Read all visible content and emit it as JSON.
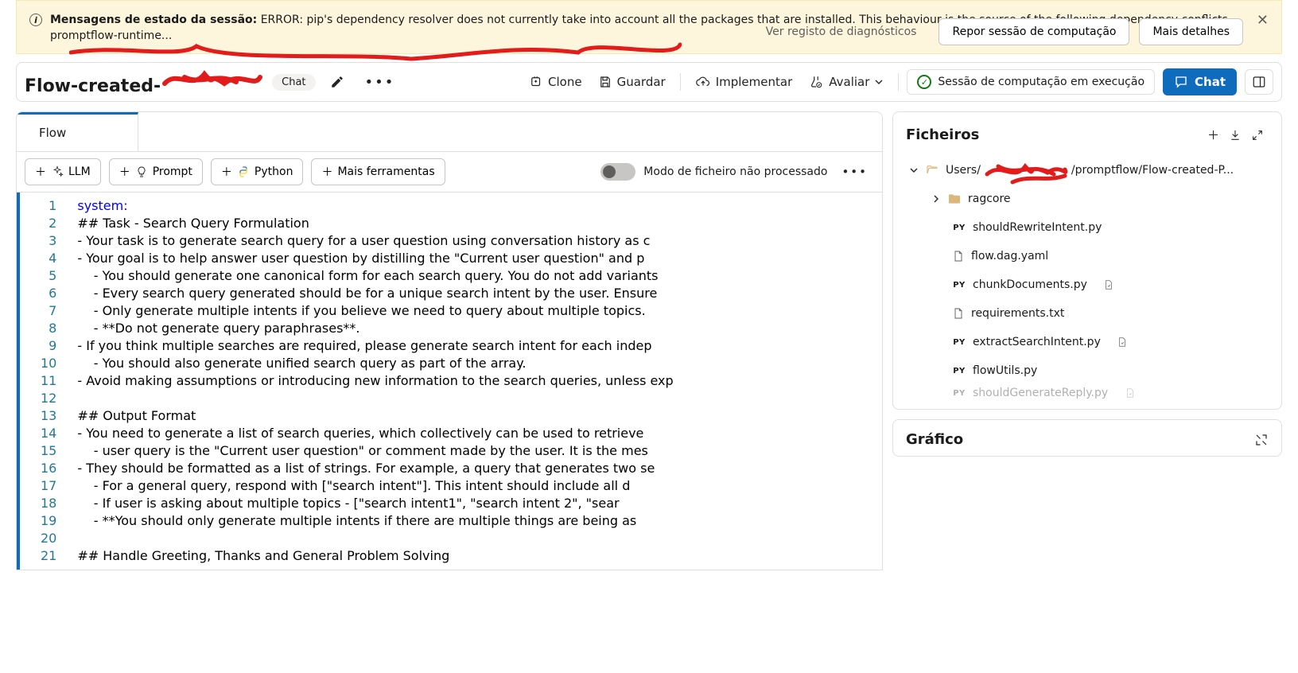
{
  "banner": {
    "title": "Mensagens de estado da sessão:",
    "message": "ERROR: pip's dependency resolver does not currently take into account all the packages that are installed. This behaviour is the source of the following dependency conflicts. promptflow-runtime...",
    "ghost_btn": "Ver registo de diagnósticos",
    "repor_btn": "Repor sessão de computação",
    "detalhes_btn": "Mais detalhes"
  },
  "toolbar": {
    "title_prefix": "Flow-created-",
    "chip": "Chat",
    "clone": "Clone",
    "guardar": "Guardar",
    "implementar": "Implementar",
    "avaliar": "Avaliar",
    "session": "Sessão de computação em execução",
    "chat": "Chat"
  },
  "editor": {
    "tab": "Flow",
    "btn_llm": "LLM",
    "btn_prompt": "Prompt",
    "btn_python": "Python",
    "btn_more": "Mais ferramentas",
    "raw": "Modo de ficheiro não processado",
    "lines": [
      {
        "n": 1,
        "t": "system:",
        "kw": true
      },
      {
        "n": 2,
        "t": "## Task - Search Query Formulation"
      },
      {
        "n": 3,
        "t": "- Your task is to generate search query for a user question using conversation history as c"
      },
      {
        "n": 4,
        "t": "- Your goal is to help answer user question by distilling the \"Current user question\" and p"
      },
      {
        "n": 5,
        "t": "    - You should generate one canonical form for each search query. You do not add variants"
      },
      {
        "n": 6,
        "t": "    - Every search query generated should be for a unique search intent by the user. Ensure"
      },
      {
        "n": 7,
        "t": "    - Only generate multiple intents if you believe we need to query about multiple topics."
      },
      {
        "n": 8,
        "t": "    - **Do not generate query paraphrases**."
      },
      {
        "n": 9,
        "t": "- If you think multiple searches are required, please generate search intent for each indep"
      },
      {
        "n": 10,
        "t": "    - You should also generate unified search query as part of the array."
      },
      {
        "n": 11,
        "t": "- Avoid making assumptions or introducing new information to the search queries, unless exp"
      },
      {
        "n": 12,
        "t": ""
      },
      {
        "n": 13,
        "t": "## Output Format"
      },
      {
        "n": 14,
        "t": "- You need to generate a list of search queries, which collectively can be used to retrieve"
      },
      {
        "n": 15,
        "t": "    - user query is the \"Current user question\" or comment made by the user. It is the mes"
      },
      {
        "n": 16,
        "t": "- They should be formatted as a list of strings. For example, a query that generates two se"
      },
      {
        "n": 17,
        "t": "    - For a general query, respond with [\"search intent\"]. This intent should include all d"
      },
      {
        "n": 18,
        "t": "    - If user is asking about multiple topics - [\"search intent1\", \"search intent 2\", \"sear"
      },
      {
        "n": 19,
        "t": "    - **You should only generate multiple intents if there are multiple things are being as"
      },
      {
        "n": 20,
        "t": ""
      },
      {
        "n": 21,
        "t": "## Handle Greeting, Thanks and General Problem Solving"
      }
    ]
  },
  "files": {
    "title": "Ficheiros",
    "path_pre": "Users/",
    "path_post": "/promptflow/Flow-created-P...",
    "folder": "ragcore",
    "items": [
      {
        "name": "shouldRewriteIntent.py",
        "type": "py"
      },
      {
        "name": "flow.dag.yaml",
        "type": "file"
      },
      {
        "name": "chunkDocuments.py",
        "type": "py",
        "extra": true
      },
      {
        "name": "requirements.txt",
        "type": "file"
      },
      {
        "name": "extractSearchIntent.py",
        "type": "py",
        "extra": true
      },
      {
        "name": "flowUtils.py",
        "type": "py"
      },
      {
        "name": "shouldGenerateReply.py",
        "type": "py",
        "extra": true,
        "cut": true
      }
    ]
  },
  "grafico": {
    "title": "Gráfico"
  }
}
